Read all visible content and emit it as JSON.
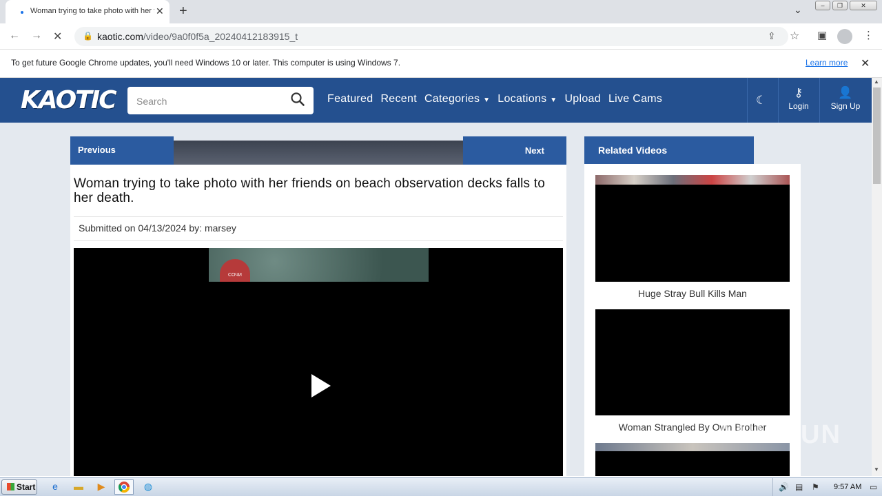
{
  "browser": {
    "tab_title": "Woman trying to take photo with her friends on beach",
    "url_domain": "kaotic.com",
    "url_path": "/video/9a0f0f5a_20240412183915_t",
    "infobar_message": "To get future Google Chrome updates, you'll need Windows 10 or later. This computer is using Windows 7.",
    "infobar_link": "Learn more"
  },
  "site": {
    "logo": "KAOTIC",
    "search_placeholder": "Search",
    "nav": {
      "featured": "Featured",
      "recent": "Recent",
      "categories": "Categories",
      "locations": "Locations",
      "upload": "Upload",
      "live_cams": "Live Cams"
    },
    "login": "Login",
    "signup": "Sign Up"
  },
  "video": {
    "prev_label": "Previous",
    "next_label": "Next",
    "title": "Woman trying to take photo with her friends on beach observation decks falls to her death.",
    "submitted_prefix": "Submitted on",
    "date": "04/13/2024",
    "by_label": "by:",
    "author": "marsey",
    "channel_badge": "СОЧИ"
  },
  "related": {
    "header": "Related Videos",
    "items": [
      {
        "title": "Huge Stray Bull Kills Man"
      },
      {
        "title": "Woman Strangled By Own Brother"
      }
    ]
  },
  "watermark": "ANY.RUN",
  "taskbar": {
    "start_label": "Start",
    "clock": "9:57 AM"
  }
}
